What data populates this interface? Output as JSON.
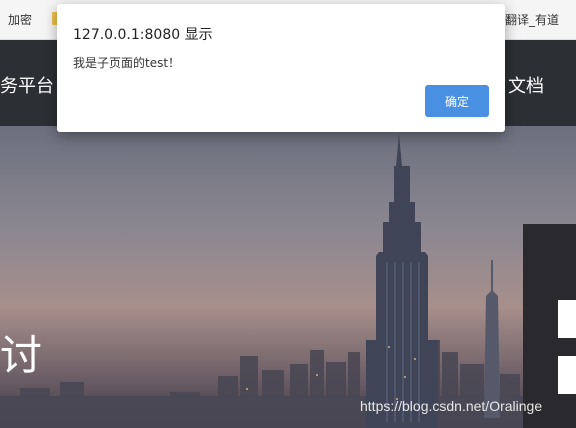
{
  "bookmarks_bar": {
    "left_item": "加密",
    "right_item": "翻译_有道"
  },
  "site_header": {
    "left_text": "务平台",
    "right_text": "文档"
  },
  "hero": {
    "glyph": "讨",
    "watermark": "https://blog.csdn.net/Oralinge"
  },
  "alert": {
    "title": "127.0.0.1:8080 显示",
    "message": "我是子页面的test！",
    "ok_label": "确定",
    "ok_color": "#4a90e2"
  }
}
